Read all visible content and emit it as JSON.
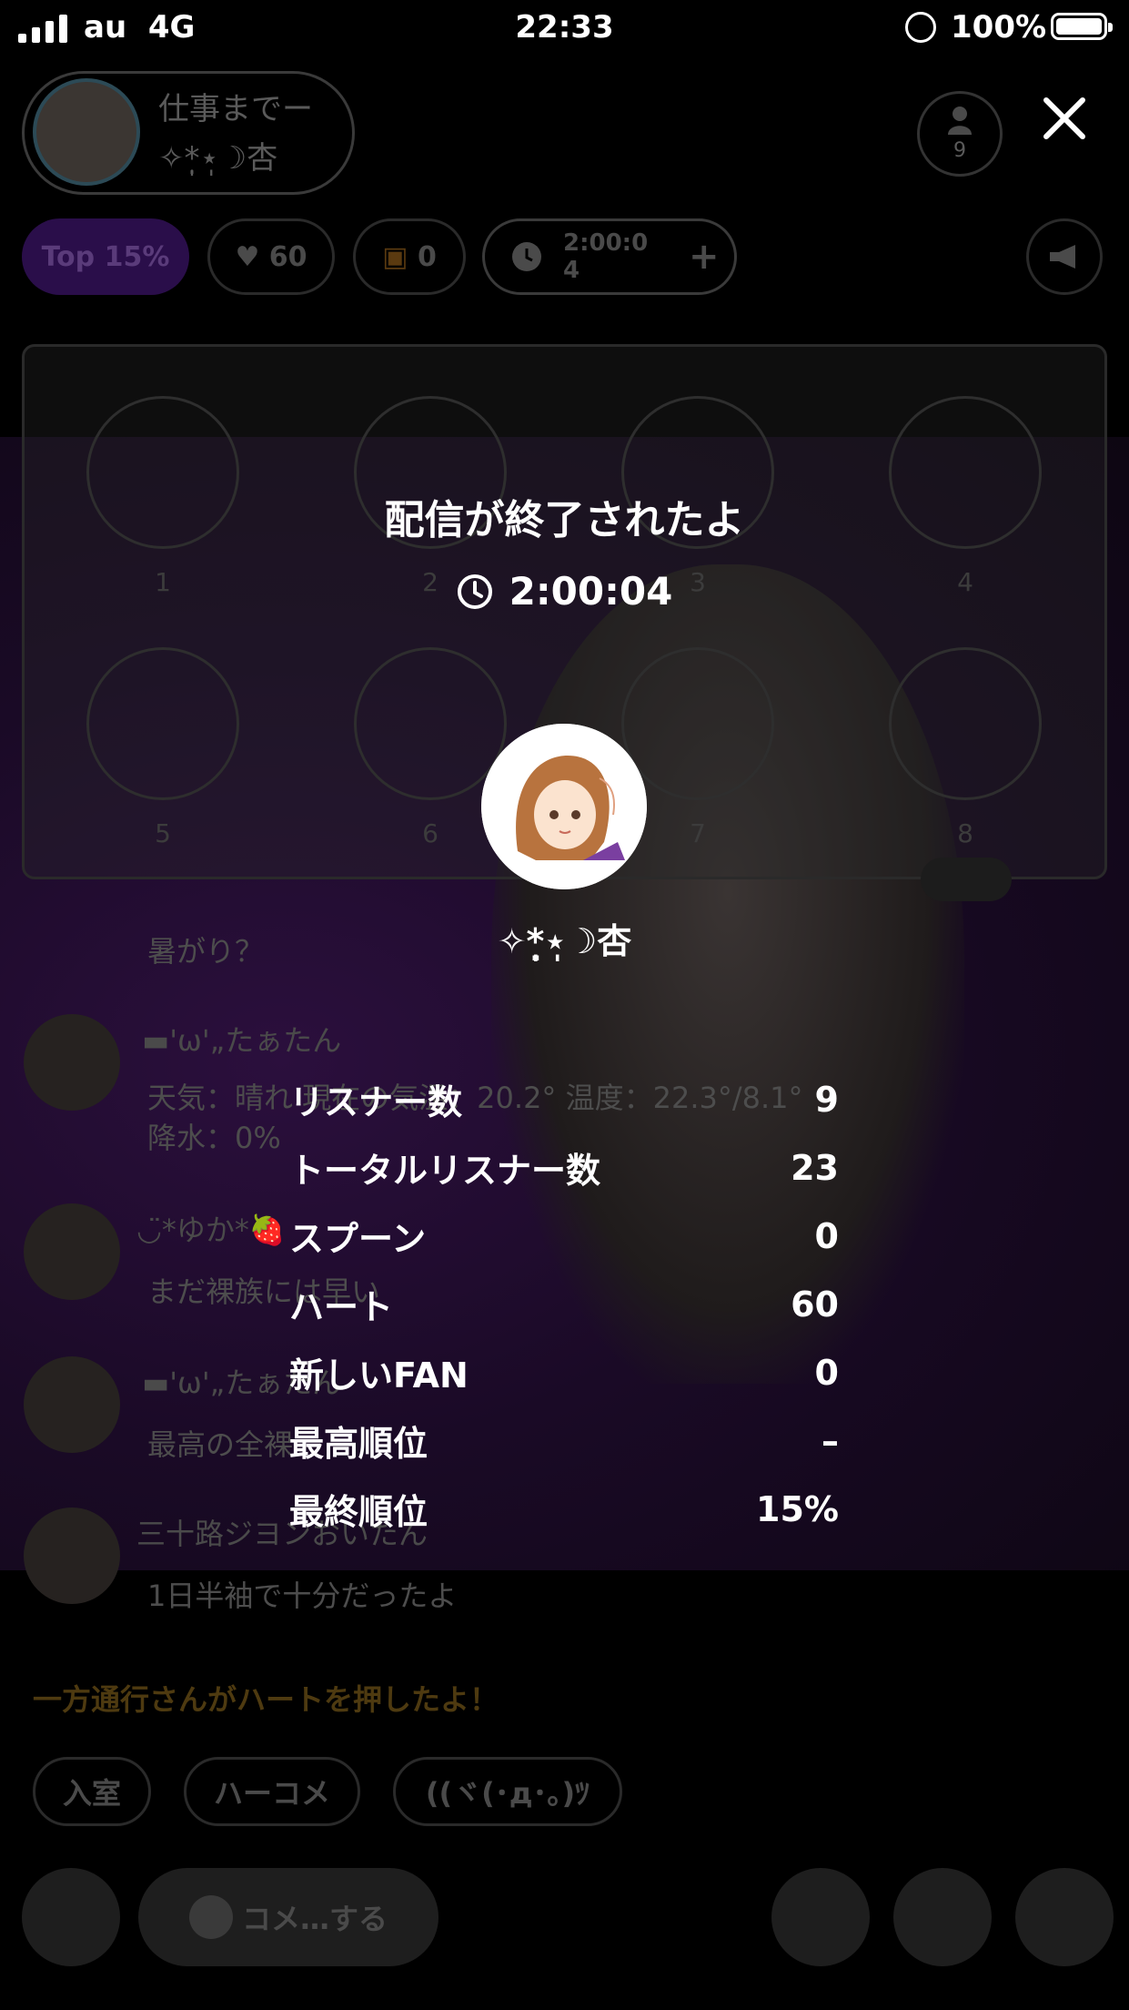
{
  "status_bar": {
    "carrier": "au",
    "network": "4G",
    "time": "22:33",
    "battery": "100%"
  },
  "background": {
    "host_title": "仕事までー",
    "host_name": "✧*̣̩⋆̩☽杏",
    "listener_count": "9",
    "chips": {
      "rank": "Top 15%",
      "hearts": "60",
      "spoons": "0",
      "timer": "2:00:0\n4"
    },
    "slots": [
      "1",
      "2",
      "3",
      "4",
      "5",
      "6",
      "7",
      "8"
    ],
    "chat": [
      {
        "name": "",
        "message": "暑がり？"
      },
      {
        "name": "▬'ω'„たぁたん",
        "message": "天気：晴れ 現在の気温：20.2° 温度：22.3°/8.1° 降水：0%"
      },
      {
        "name": "◡̈*ゆか*🍓",
        "message": "まだ裸族には早い"
      },
      {
        "name": "▬'ω'„たぁたん",
        "message": "最高の全裸"
      },
      {
        "name": "三十路ジヨンおいたん",
        "message": "1日半袖で十分だったよ"
      }
    ],
    "notice": "一方通行さんがハートを押したよ！",
    "quick_replies": [
      "入室",
      "ハーコメ",
      "((ヾ(･д･｡)ﾂ"
    ],
    "comment_placeholder": "コメ…する"
  },
  "overlay": {
    "title": "配信が終了されたよ",
    "duration": "2:00:04",
    "dj_name": "✧*̣̩⋆̩☽杏",
    "stats": [
      {
        "label": "リスナー数",
        "value": "9"
      },
      {
        "label": "トータルリスナー数",
        "value": "23"
      },
      {
        "label": "スプーン",
        "value": "0"
      },
      {
        "label": "ハート",
        "value": "60"
      },
      {
        "label": "新しいFAN",
        "value": "0"
      },
      {
        "label": "最高順位",
        "value": "–"
      },
      {
        "label": "最終順位",
        "value": "15%"
      }
    ]
  },
  "colors": {
    "rank_chip": "#2a0e4a",
    "notice": "#4e3a10",
    "accent_purple": "#6a22c8"
  }
}
